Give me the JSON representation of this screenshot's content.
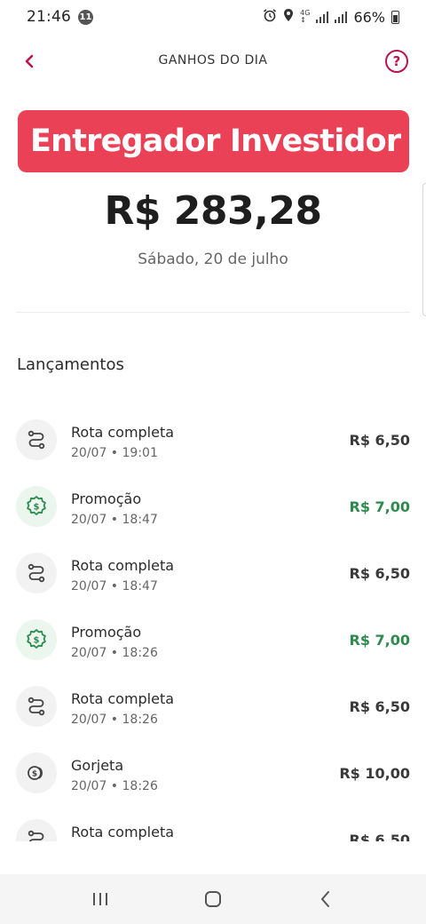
{
  "status_bar": {
    "time": "21:46",
    "notification_count": "11",
    "network": "4G",
    "battery": "66%"
  },
  "header": {
    "title": "GANHOS DO DIA",
    "back_icon": "chevron-left-icon",
    "help_icon": "question-circle-icon",
    "help_glyph": "?"
  },
  "banner": {
    "text": "Entregador Investidor",
    "color": "#ea4156"
  },
  "summary": {
    "total": "R$ 283,28",
    "date": "Sábado, 20 de julho"
  },
  "launches": {
    "title": "Lançamentos",
    "items": [
      {
        "label": "Rota completa",
        "date": "20/07 • 19:01",
        "amount": "R$ 6,50",
        "icon": "route-icon",
        "positive": false
      },
      {
        "label": "Promoção",
        "date": "20/07 • 18:47",
        "amount": "R$ 7,00",
        "icon": "promo-badge-icon",
        "positive": true
      },
      {
        "label": "Rota completa",
        "date": "20/07 • 18:47",
        "amount": "R$ 6,50",
        "icon": "route-icon",
        "positive": false
      },
      {
        "label": "Promoção",
        "date": "20/07 • 18:26",
        "amount": "R$ 7,00",
        "icon": "promo-badge-icon",
        "positive": true
      },
      {
        "label": "Rota completa",
        "date": "20/07 • 18:26",
        "amount": "R$ 6,50",
        "icon": "route-icon",
        "positive": false
      },
      {
        "label": "Gorjeta",
        "date": "20/07 • 18:26",
        "amount": "R$ 10,00",
        "icon": "coins-icon",
        "positive": false
      },
      {
        "label": "Rota completa",
        "date": "",
        "amount": "R$ 6,50",
        "icon": "route-icon",
        "positive": false
      }
    ]
  },
  "colors": {
    "accent": "#b8154c",
    "positive": "#2e8b4e"
  },
  "nav": {
    "recent_icon": "recent-apps-icon",
    "home_icon": "home-icon",
    "back_icon": "back-icon"
  }
}
